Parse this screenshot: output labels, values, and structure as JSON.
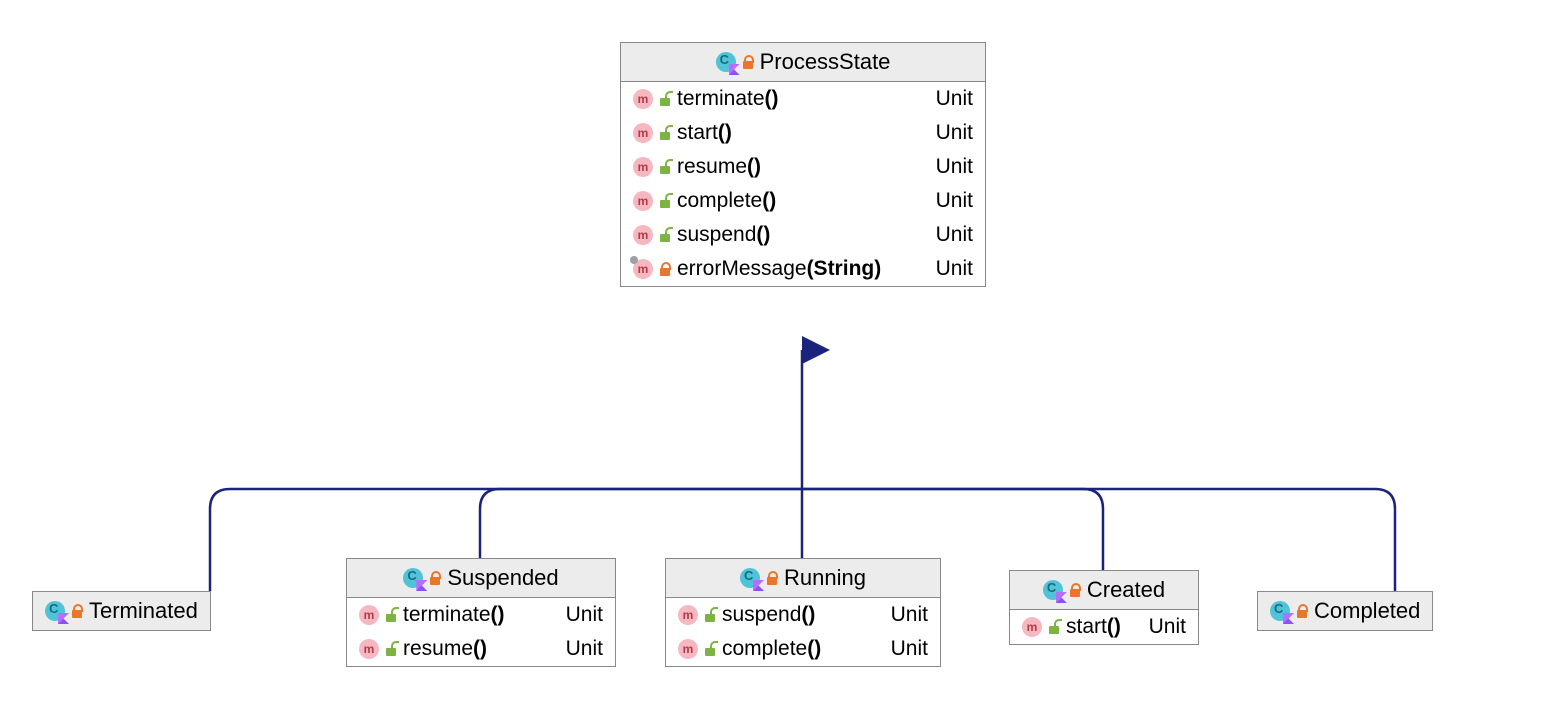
{
  "parent": {
    "name": "ProcessState",
    "members": [
      {
        "sig": "terminate",
        "params": "()",
        "type": "Unit",
        "vis": "green"
      },
      {
        "sig": "start",
        "params": "()",
        "type": "Unit",
        "vis": "green"
      },
      {
        "sig": "resume",
        "params": "()",
        "type": "Unit",
        "vis": "green"
      },
      {
        "sig": "complete",
        "params": "()",
        "type": "Unit",
        "vis": "green"
      },
      {
        "sig": "suspend",
        "params": "()",
        "type": "Unit",
        "vis": "green"
      },
      {
        "sig": "errorMessage",
        "params": "(String)",
        "type": "Unit",
        "vis": "orange",
        "abstract": true
      }
    ]
  },
  "children": {
    "terminated": {
      "name": "Terminated",
      "members": []
    },
    "suspended": {
      "name": "Suspended",
      "members": [
        {
          "sig": "terminate",
          "params": "()",
          "type": "Unit",
          "vis": "green"
        },
        {
          "sig": "resume",
          "params": "()",
          "type": "Unit",
          "vis": "green"
        }
      ]
    },
    "running": {
      "name": "Running",
      "members": [
        {
          "sig": "suspend",
          "params": "()",
          "type": "Unit",
          "vis": "green"
        },
        {
          "sig": "complete",
          "params": "()",
          "type": "Unit",
          "vis": "green"
        }
      ]
    },
    "created": {
      "name": "Created",
      "members": [
        {
          "sig": "start",
          "params": "()",
          "type": "Unit",
          "vis": "green"
        }
      ]
    },
    "completed": {
      "name": "Completed",
      "members": []
    }
  }
}
